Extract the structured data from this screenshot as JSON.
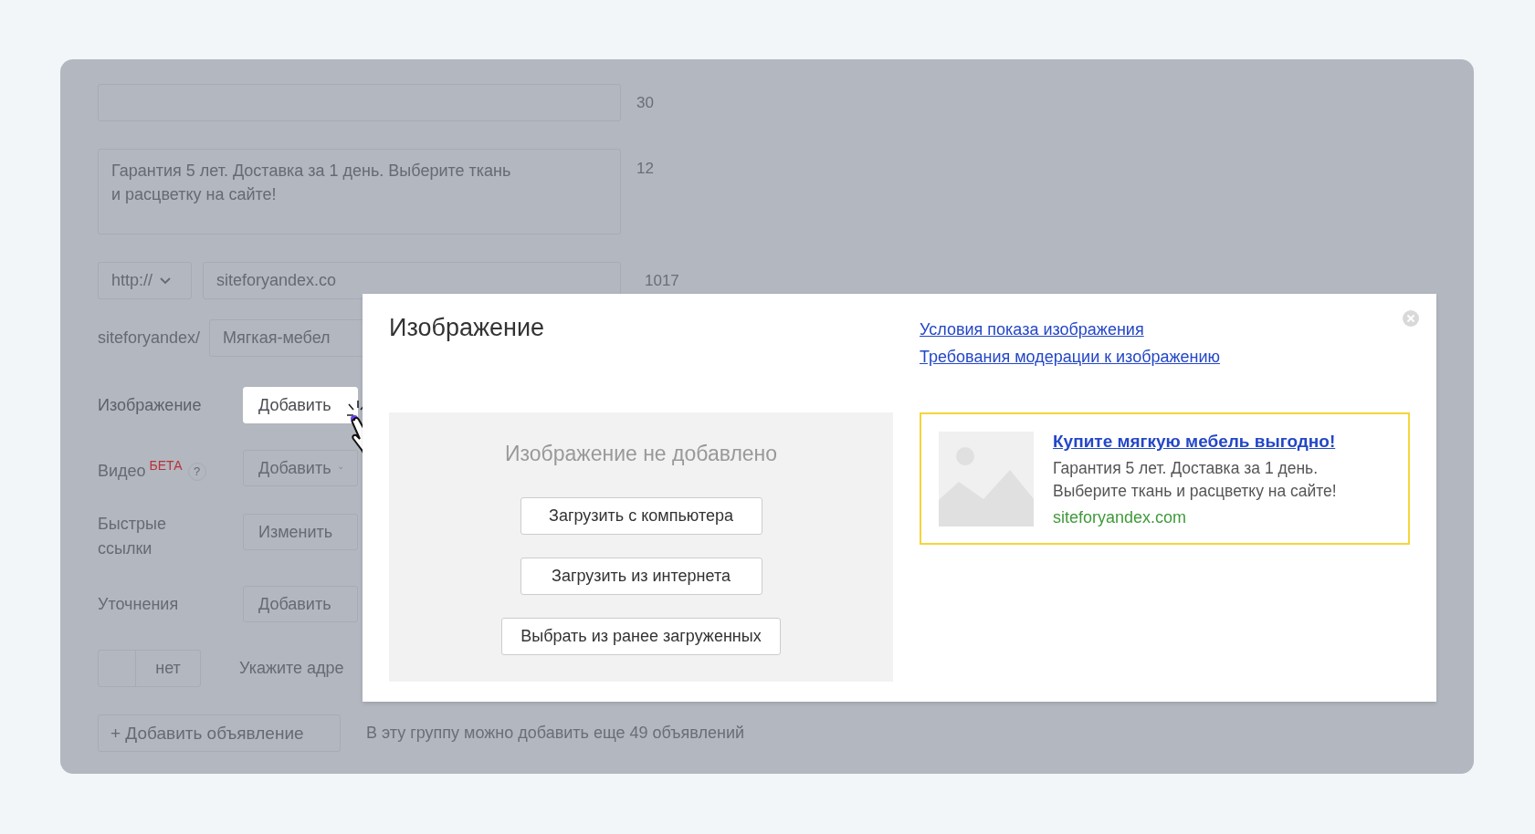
{
  "form": {
    "headline_field": {
      "counter": "30"
    },
    "text_field": {
      "value": "Гарантия 5 лет. Доставка за 1 день. Выберите ткань\nи расцветку на сайте!",
      "counter": "12"
    },
    "url": {
      "protocol": "http://",
      "value": "siteforyandex.co",
      "counter": "1017"
    },
    "display_link": {
      "prefix": "siteforyandex/",
      "value": "Мягкая-мебел"
    },
    "rows": [
      {
        "label": "Изображение",
        "button": "Добавить",
        "highlighted": true,
        "kind": "button"
      },
      {
        "label": "Видео",
        "badge": "БЕТА",
        "help": "?",
        "button": "Добавить",
        "highlighted": false,
        "kind": "dropdown"
      },
      {
        "label": "Быстрые\nссылки",
        "button": "Изменить",
        "highlighted": false,
        "kind": "button"
      },
      {
        "label": "Уточнения",
        "button": "Добавить",
        "highlighted": false,
        "kind": "button"
      }
    ],
    "toggle": {
      "label": "нет",
      "on": false
    },
    "address_hint": "Укажите адре",
    "add_button": "+ Добавить объявление",
    "note": "В эту группу можно добавить еще 49 объявлений"
  },
  "modal": {
    "title": "Изображение",
    "links": [
      "Условия показа изображения",
      "Требования модерации к изображению"
    ],
    "empty_text": "Изображение не добавлено",
    "buttons": [
      "Загрузить с компьютера",
      "Загрузить из интернета",
      "Выбрать из ранее загруженных"
    ],
    "preview": {
      "title": "Купите мягкую мебель выгодно!",
      "text": "Гарантия 5 лет. Доставка за 1 день.\nВыберите ткань и расцветку на сайте!",
      "url": "siteforyandex.com"
    }
  }
}
